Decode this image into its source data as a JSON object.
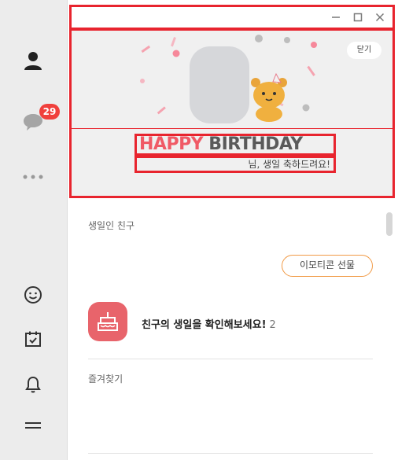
{
  "sidebar": {
    "items": [
      {
        "name": "friends",
        "icon": "person-icon"
      },
      {
        "name": "chats",
        "icon": "chat-bubble-icon",
        "badge": "29"
      },
      {
        "name": "more",
        "icon": "more-dots-icon"
      }
    ],
    "bottom_items": [
      {
        "name": "emoticon",
        "icon": "smiley-icon"
      },
      {
        "name": "calendar",
        "icon": "calendar-check-icon"
      },
      {
        "name": "notifications",
        "icon": "bell-icon"
      },
      {
        "name": "menu",
        "icon": "hamburger-menu-icon"
      }
    ]
  },
  "window": {
    "controls": [
      "minimize",
      "maximize",
      "close"
    ]
  },
  "banner": {
    "close_label": "닫기",
    "title_part1": "HAPPY",
    "title_part2": "BIRTHDAY",
    "message": "님, 생일 축하드려요!"
  },
  "main": {
    "birthday_section_label": "생일인 친구",
    "emoticon_gift_button": "이모티콘 선물",
    "friend_prompt": "친구의 생일을 확인해보세요!",
    "friend_count": "2",
    "favorites_label": "즐겨찾기"
  },
  "colors": {
    "accent_red": "#e8242e",
    "happy_pink": "#f05a66",
    "birthday_gray": "#5a5a5a",
    "badge_red": "#f0403c",
    "button_orange": "#f19a45",
    "cake_tile": "#e8646b"
  }
}
